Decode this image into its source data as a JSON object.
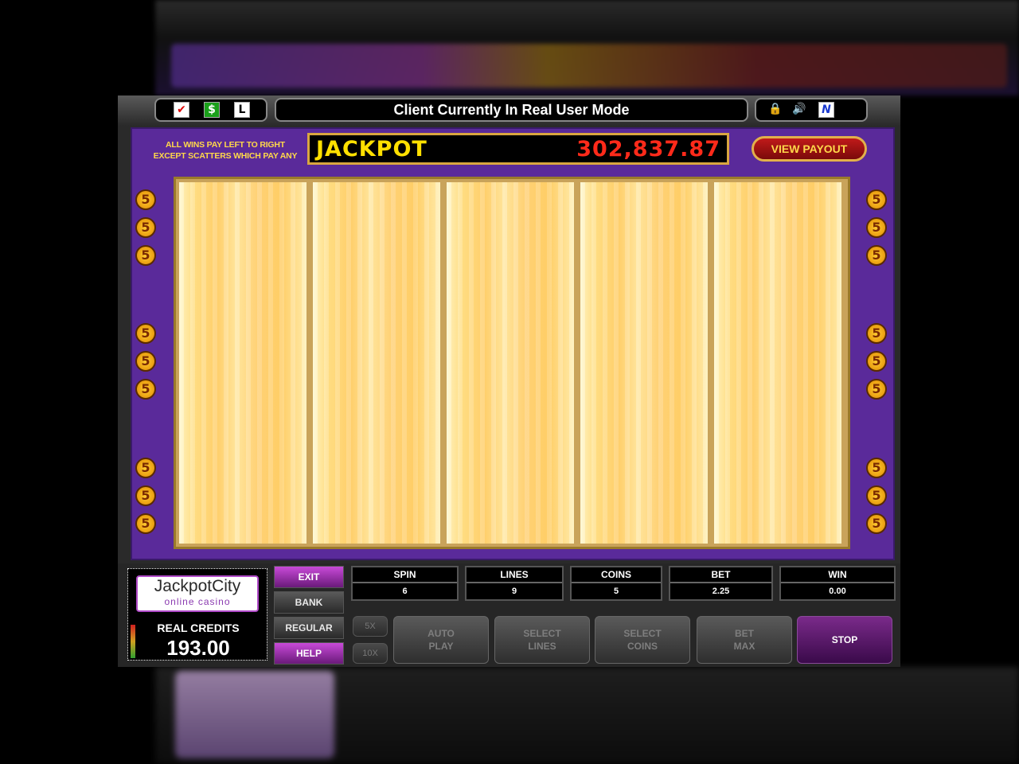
{
  "top_bar": {
    "mode_title": "Client Currently In Real User Mode",
    "left_icons": [
      "check-icon",
      "dollar-icon",
      "letter-l-icon"
    ],
    "right_icons": [
      "lock-icon",
      "speaker-icon",
      "n-logo-icon"
    ],
    "icon_glyphs": {
      "check": "✔",
      "dollar": "$",
      "l": "L",
      "lock": "🔒",
      "speaker": "🔊",
      "n": "N"
    }
  },
  "machine": {
    "pay_rule_line1": "ALL WINS PAY LEFT TO RIGHT",
    "pay_rule_line2": "EXCEPT SCATTERS WHICH PAY ANY",
    "jackpot_label": "JACKPOT",
    "jackpot_value": "302,837.87",
    "view_payout_label": "VIEW PAYOUT",
    "marker_label": "5",
    "colors": {
      "panel": "#5a2a9a",
      "jackpot_text": "#ffe000",
      "jackpot_value": "#ff2a1a",
      "marker": "#ffcc33"
    }
  },
  "logo": {
    "name": "JackpotCity",
    "sub": "online casino",
    "credits_label": "REAL CREDITS",
    "credits_value": "193.00"
  },
  "side_buttons": {
    "exit": "EXIT",
    "bank": "BANK",
    "regular": "REGULAR",
    "help": "HELP"
  },
  "stats": {
    "spin": {
      "label": "SPIN",
      "value": "6"
    },
    "lines": {
      "label": "LINES",
      "value": "9"
    },
    "coins": {
      "label": "COINS",
      "value": "5"
    },
    "bet": {
      "label": "BET",
      "value": "2.25"
    },
    "win": {
      "label": "WIN",
      "value": "0.00"
    }
  },
  "controls": {
    "mult_5x": "5X",
    "mult_10x": "10X",
    "auto_play_1": "AUTO",
    "auto_play_2": "PLAY",
    "select_lines_1": "SELECT",
    "select_lines_2": "LINES",
    "select_coins_1": "SELECT",
    "select_coins_2": "COINS",
    "bet_max_1": "BET",
    "bet_max_2": "MAX",
    "stop": "STOP"
  }
}
